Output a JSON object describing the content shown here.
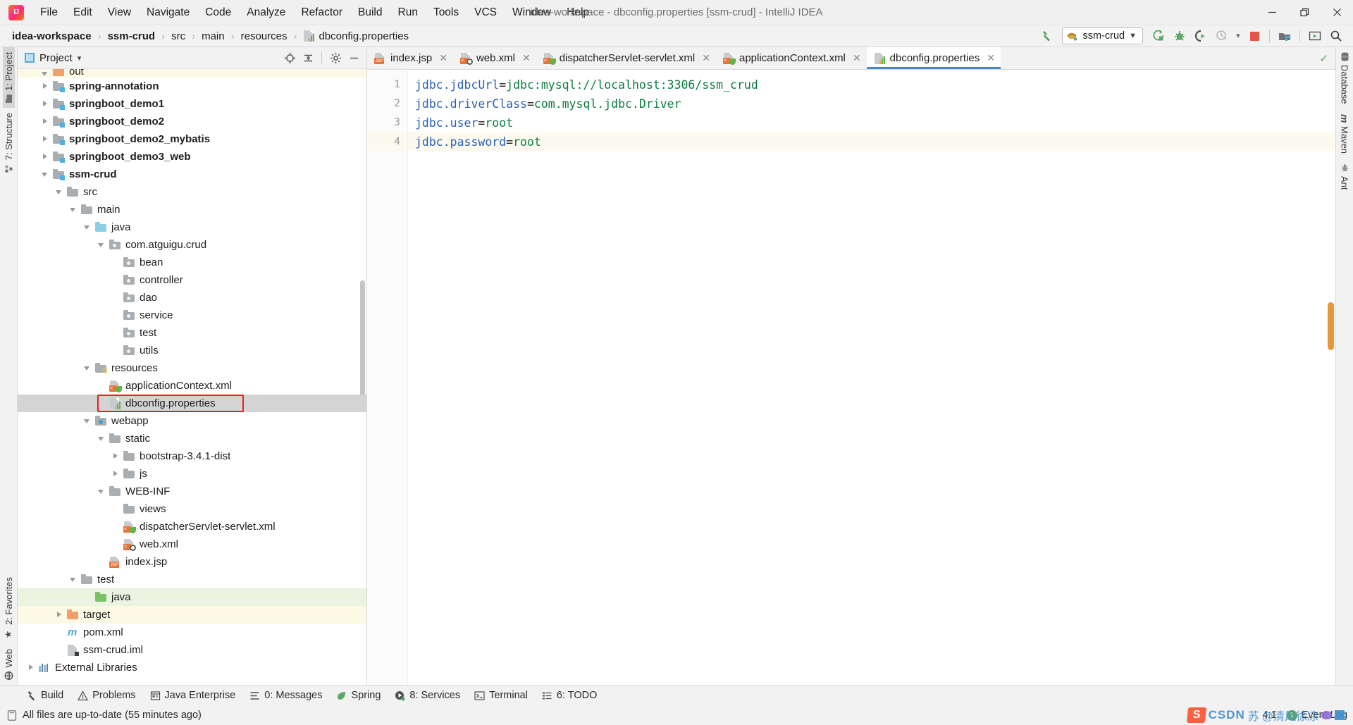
{
  "window": {
    "title": "idea-workspace - dbconfig.properties [ssm-crud] - IntelliJ IDEA",
    "minimize": "—",
    "restore": "❐",
    "close": "✕"
  },
  "menu": [
    {
      "label": "File"
    },
    {
      "label": "Edit"
    },
    {
      "label": "View"
    },
    {
      "label": "Navigate"
    },
    {
      "label": "Code"
    },
    {
      "label": "Analyze"
    },
    {
      "label": "Refactor"
    },
    {
      "label": "Build"
    },
    {
      "label": "Run"
    },
    {
      "label": "Tools"
    },
    {
      "label": "VCS"
    },
    {
      "label": "Window"
    },
    {
      "label": "Help"
    }
  ],
  "breadcrumb": [
    {
      "label": "idea-workspace",
      "bold": true
    },
    {
      "label": "ssm-crud",
      "bold": true
    },
    {
      "label": "src",
      "bold": false
    },
    {
      "label": "main",
      "bold": false
    },
    {
      "label": "resources",
      "bold": false
    },
    {
      "label": "dbconfig.properties",
      "bold": false,
      "icon": "properties-file-icon"
    }
  ],
  "toolbar": {
    "build_hammer": "build-icon",
    "run_config": "ssm-crud",
    "run": "run-icon",
    "debug": "debug-icon",
    "run_coverage": "run-with-coverage-icon",
    "profiler": "profiler-icon",
    "stop": "stop-icon",
    "stop_color": "#e4564a",
    "update_project": "update-project-icon",
    "present_mode": "presentation-mode-icon",
    "search_everywhere": "search-everywhere-icon"
  },
  "left_strip": [
    {
      "label": "1: Project",
      "active": true,
      "icon": "project-icon"
    },
    {
      "label": "7: Structure",
      "active": false,
      "icon": "structure-icon"
    },
    {
      "label": "2: Favorites",
      "active": false,
      "icon": "star-icon"
    },
    {
      "label": "Web",
      "active": false,
      "icon": "web-icon"
    }
  ],
  "right_strip": [
    {
      "label": "Database",
      "icon": "database-icon"
    },
    {
      "label": "Maven",
      "icon": "maven-icon"
    },
    {
      "label": "Ant",
      "icon": "ant-icon"
    }
  ],
  "project_panel": {
    "title": "Project",
    "dropdown": "▾",
    "actions": [
      "locate-icon",
      "collapse-all-icon",
      "settings-gear-icon",
      "hide-icon"
    ]
  },
  "tree": [
    {
      "label": "out",
      "depth": 1,
      "arrow": "down",
      "icon": "folder-orange",
      "bold": false,
      "row": "yellow",
      "clipped": true
    },
    {
      "label": "spring-annotation",
      "depth": 1,
      "arrow": "right",
      "icon": "module",
      "bold": true,
      "row": ""
    },
    {
      "label": "springboot_demo1",
      "depth": 1,
      "arrow": "right",
      "icon": "module",
      "bold": true,
      "row": ""
    },
    {
      "label": "springboot_demo2",
      "depth": 1,
      "arrow": "right",
      "icon": "module",
      "bold": true,
      "row": ""
    },
    {
      "label": "springboot_demo2_mybatis",
      "depth": 1,
      "arrow": "right",
      "icon": "module",
      "bold": true,
      "row": ""
    },
    {
      "label": "springboot_demo3_web",
      "depth": 1,
      "arrow": "right",
      "icon": "module",
      "bold": true,
      "row": ""
    },
    {
      "label": "ssm-crud",
      "depth": 1,
      "arrow": "down",
      "icon": "module",
      "bold": true,
      "row": ""
    },
    {
      "label": "src",
      "depth": 2,
      "arrow": "down",
      "icon": "folder-gray",
      "bold": false,
      "row": ""
    },
    {
      "label": "main",
      "depth": 3,
      "arrow": "down",
      "icon": "folder-gray",
      "bold": false,
      "row": ""
    },
    {
      "label": "java",
      "depth": 4,
      "arrow": "down",
      "icon": "folder-blue",
      "bold": false,
      "row": ""
    },
    {
      "label": "com.atguigu.crud",
      "depth": 5,
      "arrow": "down",
      "icon": "package",
      "bold": false,
      "row": ""
    },
    {
      "label": "bean",
      "depth": 6,
      "arrow": "none",
      "icon": "package",
      "bold": false,
      "row": ""
    },
    {
      "label": "controller",
      "depth": 6,
      "arrow": "none",
      "icon": "package",
      "bold": false,
      "row": ""
    },
    {
      "label": "dao",
      "depth": 6,
      "arrow": "none",
      "icon": "package",
      "bold": false,
      "row": ""
    },
    {
      "label": "service",
      "depth": 6,
      "arrow": "none",
      "icon": "package",
      "bold": false,
      "row": ""
    },
    {
      "label": "test",
      "depth": 6,
      "arrow": "none",
      "icon": "package",
      "bold": false,
      "row": ""
    },
    {
      "label": "utils",
      "depth": 6,
      "arrow": "none",
      "icon": "package",
      "bold": false,
      "row": ""
    },
    {
      "label": "resources",
      "depth": 4,
      "arrow": "down",
      "icon": "folder-resources",
      "bold": false,
      "row": ""
    },
    {
      "label": "applicationContext.xml",
      "depth": 5,
      "arrow": "none",
      "icon": "spring-xml",
      "bold": false,
      "row": ""
    },
    {
      "label": "dbconfig.properties",
      "depth": 5,
      "arrow": "none",
      "icon": "properties",
      "bold": false,
      "row": "sel",
      "annotated": true
    },
    {
      "label": "webapp",
      "depth": 4,
      "arrow": "down",
      "icon": "webapp",
      "bold": false,
      "row": ""
    },
    {
      "label": "static",
      "depth": 5,
      "arrow": "down",
      "icon": "folder-gray",
      "bold": false,
      "row": ""
    },
    {
      "label": "bootstrap-3.4.1-dist",
      "depth": 6,
      "arrow": "right",
      "icon": "folder-gray",
      "bold": false,
      "row": ""
    },
    {
      "label": "js",
      "depth": 6,
      "arrow": "right",
      "icon": "folder-gray",
      "bold": false,
      "row": ""
    },
    {
      "label": "WEB-INF",
      "depth": 5,
      "arrow": "down",
      "icon": "folder-gray",
      "bold": false,
      "row": ""
    },
    {
      "label": "views",
      "depth": 6,
      "arrow": "none",
      "icon": "folder-gray",
      "bold": false,
      "row": ""
    },
    {
      "label": "dispatcherServlet-servlet.xml",
      "depth": 6,
      "arrow": "none",
      "icon": "spring-xml",
      "bold": false,
      "row": ""
    },
    {
      "label": "web.xml",
      "depth": 6,
      "arrow": "none",
      "icon": "web-xml",
      "bold": false,
      "row": ""
    },
    {
      "label": "index.jsp",
      "depth": 5,
      "arrow": "none",
      "icon": "jsp",
      "bold": false,
      "row": ""
    },
    {
      "label": "test",
      "depth": 3,
      "arrow": "down",
      "icon": "folder-gray",
      "bold": false,
      "row": ""
    },
    {
      "label": "java",
      "depth": 4,
      "arrow": "none",
      "icon": "folder-green",
      "bold": false,
      "row": "green"
    },
    {
      "label": "target",
      "depth": 2,
      "arrow": "right",
      "icon": "folder-orange",
      "bold": false,
      "row": "yellow"
    },
    {
      "label": "pom.xml",
      "depth": 2,
      "arrow": "none",
      "icon": "maven-pom",
      "bold": false,
      "row": ""
    },
    {
      "label": "ssm-crud.iml",
      "depth": 2,
      "arrow": "none",
      "icon": "iml",
      "bold": false,
      "row": ""
    },
    {
      "label": "External Libraries",
      "depth": 0,
      "arrow": "right",
      "icon": "libraries",
      "bold": false,
      "row": ""
    }
  ],
  "editor_tabs": [
    {
      "label": "index.jsp",
      "icon": "jsp-file-icon",
      "active": false
    },
    {
      "label": "web.xml",
      "icon": "web-xml-file-icon",
      "active": false
    },
    {
      "label": "dispatcherServlet-servlet.xml",
      "icon": "spring-xml-file-icon",
      "active": false
    },
    {
      "label": "applicationContext.xml",
      "icon": "spring-xml-file-icon",
      "active": false
    },
    {
      "label": "dbconfig.properties",
      "icon": "properties-file-icon",
      "active": true
    }
  ],
  "editor": {
    "close_glyph": "✕",
    "inspection_ok": "✓",
    "lines": [
      {
        "no": "1",
        "key": "jdbc.jdbcUrl",
        "eq": "=",
        "value": "jdbc:mysql://localhost:3306/ssm_crud",
        "current": false
      },
      {
        "no": "2",
        "key": "jdbc.driverClass",
        "eq": "=",
        "value": "com.mysql.jdbc.Driver",
        "current": false
      },
      {
        "no": "3",
        "key": "jdbc.user",
        "eq": "=",
        "value": "root",
        "current": false
      },
      {
        "no": "4",
        "key": "jdbc.password",
        "eq": "=",
        "value": "root",
        "current": true
      }
    ]
  },
  "bottom_tools": [
    {
      "label": "Build",
      "icon": "build-hammer-icon"
    },
    {
      "label": "Problems",
      "icon": "warning-triangle-icon"
    },
    {
      "label": "Java Enterprise",
      "icon": "java-enterprise-icon"
    },
    {
      "label": "0: Messages",
      "icon": "messages-icon"
    },
    {
      "label": "Spring",
      "icon": "spring-leaf-icon"
    },
    {
      "label": "8: Services",
      "icon": "services-icon"
    },
    {
      "label": "Terminal",
      "icon": "terminal-icon"
    },
    {
      "label": "6: TODO",
      "icon": "todo-icon"
    }
  ],
  "status": {
    "message": "All files are up-to-date (55 minutes ago)",
    "message_icon": "document-sync-icon",
    "caret": "4:1",
    "event_log": "Event Log",
    "event_count": "1"
  },
  "watermark": {
    "logo": "S",
    "brand": "CSDN",
    "author": "@清风徐凉",
    "cn1": "苏",
    "cn2": "哩"
  },
  "colors": {
    "accent_tab": "#4a86c8",
    "key": "#2b5fb3",
    "value": "#0a7d3e",
    "selection": "#d4d4d4",
    "annotation": "#f01c1c",
    "test_root": "#e9f5e0",
    "excluded": "#fcfae4",
    "scrollbar": "#e8963c"
  }
}
